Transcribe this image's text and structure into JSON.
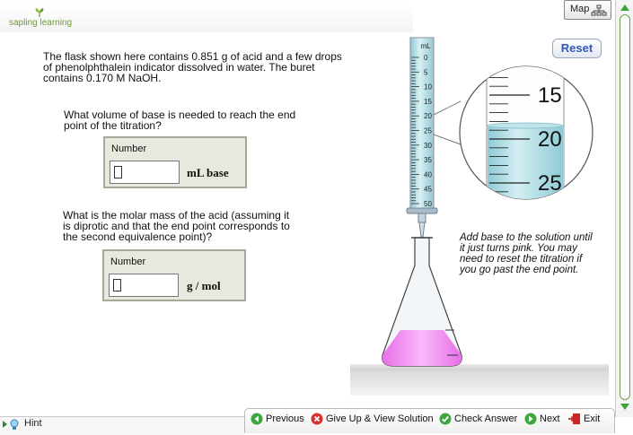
{
  "logo": {
    "text": "sapling learning"
  },
  "map_button": {
    "label": "Map"
  },
  "problem": {
    "intro_lines": [
      "The flask shown here contains 0.851 g of acid and a few drops",
      "of phenolphthalein indicator dissolved in water. The buret",
      "contains 0.170 M NaOH."
    ]
  },
  "question1": {
    "lines": [
      "What volume of base is needed to reach the end",
      "point of the titration?"
    ],
    "box_label": "Number",
    "value": "",
    "unit": "mL  base"
  },
  "question2": {
    "lines": [
      "What is the molar mass of the acid (assuming it",
      "is diprotic and that the end point corresponds to",
      "the second equivalence point)?"
    ],
    "box_label": "Number",
    "value": "",
    "unit": "g / mol"
  },
  "reset_button": {
    "label": "Reset"
  },
  "buret": {
    "unit_label": "mL",
    "scale_labels": [
      "0",
      "5",
      "10",
      "15",
      "20",
      "25",
      "30",
      "35",
      "40",
      "45",
      "50"
    ],
    "magnified_labels": [
      "15",
      "20",
      "25"
    ],
    "liquid_color": "#a9dde6"
  },
  "flask": {
    "solution_color": "#f08ff0"
  },
  "instructions": {
    "lines": [
      "Add base to the solution until",
      "it just turns pink. You may",
      "need to reset the titration if",
      "you go past the end point."
    ]
  },
  "footer": {
    "hint": "Hint",
    "previous": "Previous",
    "give_up": "Give Up & View Solution",
    "check": "Check Answer",
    "next": "Next",
    "exit": "Exit"
  },
  "colors": {
    "brand_green": "#6d9a32",
    "reset_blue": "#3059b8",
    "answer_box_bg": "#e9e8de"
  }
}
